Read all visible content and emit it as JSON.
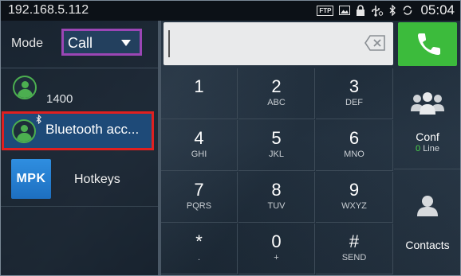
{
  "status_bar": {
    "ip_address": "192.168.5.112",
    "ftp_badge": "FTP",
    "icons": [
      "ftp-icon",
      "image-icon",
      "lock-icon",
      "usb-icon",
      "bluetooth-icon",
      "sync-icon"
    ],
    "time": "05:04"
  },
  "mode": {
    "label": "Mode",
    "selected": "Call"
  },
  "accounts": [
    {
      "label": "1400",
      "icon": "contact-avatar-icon"
    },
    {
      "label": "Bluetooth acc...",
      "icon": "contact-avatar-icon",
      "badge_icon": "bluetooth-icon"
    }
  ],
  "hotkeys": {
    "icon_text": "MPK",
    "label": "Hotkeys"
  },
  "dialer": {
    "number_value": "",
    "keys": [
      {
        "digit": "1",
        "letters": ""
      },
      {
        "digit": "2",
        "letters": "ABC"
      },
      {
        "digit": "3",
        "letters": "DEF"
      },
      {
        "digit": "4",
        "letters": "GHI"
      },
      {
        "digit": "5",
        "letters": "JKL"
      },
      {
        "digit": "6",
        "letters": "MNO"
      },
      {
        "digit": "7",
        "letters": "PQRS"
      },
      {
        "digit": "8",
        "letters": "TUV"
      },
      {
        "digit": "9",
        "letters": "WXYZ"
      },
      {
        "digit": "*",
        "letters": "."
      },
      {
        "digit": "0",
        "letters": "+"
      },
      {
        "digit": "#",
        "letters": "SEND"
      }
    ]
  },
  "side_buttons": {
    "conf_label": "Conf",
    "conf_count": "0",
    "conf_unit": "Line",
    "contacts_label": "Contacts"
  },
  "colors": {
    "call_green": "#3cbb3c",
    "mode_highlight": "#9b46b5",
    "selection_highlight": "#e02020",
    "selected_row": "#1e4a78",
    "avatar_green": "#4caf50"
  }
}
